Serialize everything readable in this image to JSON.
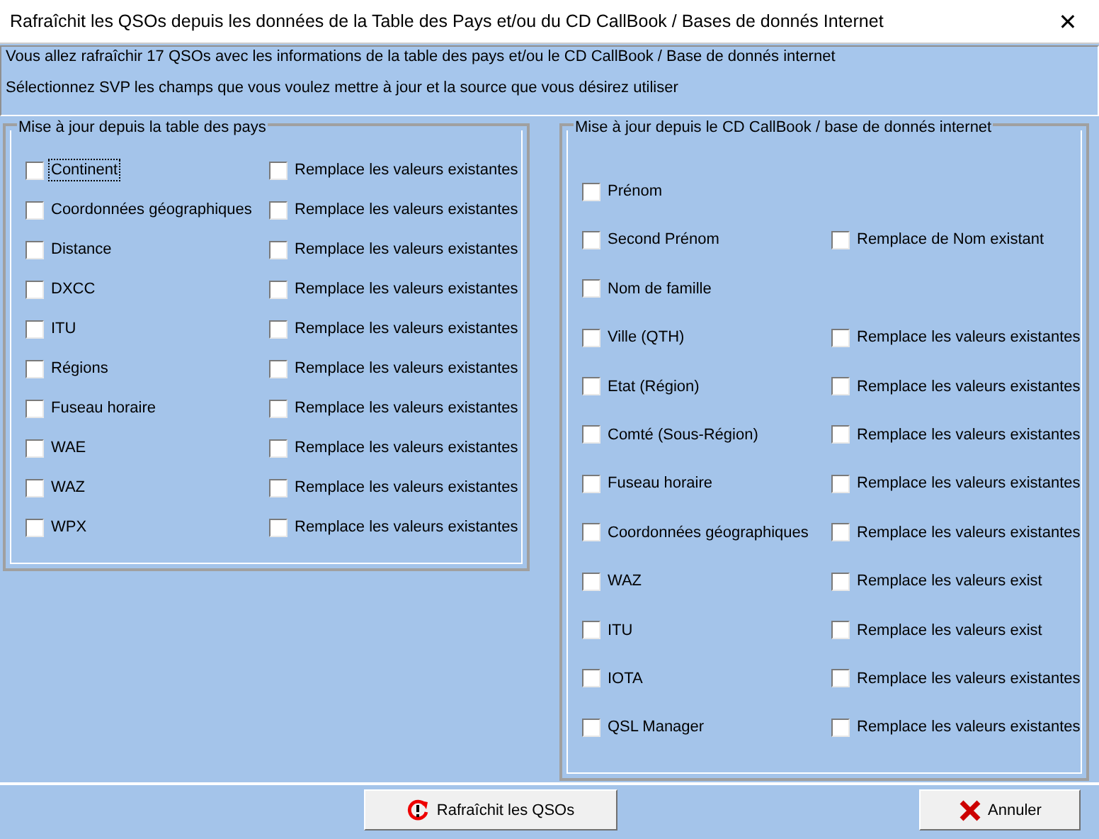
{
  "window": {
    "title": "Rafraîchit les QSOs depuis les données de la Table des Pays et/ou du CD CallBook / Bases de donnés Internet",
    "close": "✕"
  },
  "info": [
    "Vous allez rafraîchir 17 QSOs avec les informations de la table des pays et/ou le CD CallBook / Base de donnés internet",
    "Sélectionnez SVP les champs que vous voulez mettre à jour et la source que vous désirez utiliser"
  ],
  "groups": [
    {
      "title": "Mise à jour depuis la table des pays",
      "rows": [
        {
          "label": "Continent",
          "checked": false,
          "focused": true,
          "replace": {
            "label": "Remplace les valeurs existantes",
            "checked": false
          }
        },
        {
          "label": "Coordonnées géographiques",
          "checked": false,
          "focused": false,
          "replace": {
            "label": "Remplace les valeurs existantes",
            "checked": false
          }
        },
        {
          "label": "Distance",
          "checked": false,
          "focused": false,
          "replace": {
            "label": "Remplace les valeurs existantes",
            "checked": false
          }
        },
        {
          "label": "DXCC",
          "checked": false,
          "focused": false,
          "replace": {
            "label": "Remplace les valeurs existantes",
            "checked": false
          }
        },
        {
          "label": "ITU",
          "checked": false,
          "focused": false,
          "replace": {
            "label": "Remplace les valeurs existantes",
            "checked": false
          }
        },
        {
          "label": "Régions",
          "checked": false,
          "focused": false,
          "replace": {
            "label": "Remplace les valeurs existantes",
            "checked": false
          }
        },
        {
          "label": "Fuseau horaire",
          "checked": false,
          "focused": false,
          "replace": {
            "label": "Remplace les valeurs existantes",
            "checked": false
          }
        },
        {
          "label": "WAE",
          "checked": false,
          "focused": false,
          "replace": {
            "label": "Remplace les valeurs existantes",
            "checked": false
          }
        },
        {
          "label": "WAZ",
          "checked": false,
          "focused": false,
          "replace": {
            "label": "Remplace les valeurs existantes",
            "checked": false
          }
        },
        {
          "label": "WPX",
          "checked": false,
          "focused": false,
          "replace": {
            "label": "Remplace les valeurs existantes",
            "checked": false
          }
        }
      ]
    },
    {
      "title": "Mise à jour depuis le CD CallBook / base de donnés internet",
      "rows": [
        {
          "label": "Prénom",
          "checked": false,
          "focused": false
        },
        {
          "label": "Second Prénom",
          "checked": false,
          "focused": false,
          "replace": {
            "label": "Remplace de Nom existant",
            "checked": false
          }
        },
        {
          "label": "Nom de famille",
          "checked": false,
          "focused": false
        },
        {
          "label": "Ville (QTH)",
          "checked": false,
          "focused": false,
          "replace": {
            "label": "Remplace les valeurs existantes",
            "checked": false
          }
        },
        {
          "label": "Etat (Région)",
          "checked": false,
          "focused": false,
          "replace": {
            "label": "Remplace les valeurs existantes",
            "checked": false
          }
        },
        {
          "label": "Comté (Sous-Région)",
          "checked": false,
          "focused": false,
          "replace": {
            "label": "Remplace les valeurs existantes",
            "checked": false
          }
        },
        {
          "label": "Fuseau horaire",
          "checked": false,
          "focused": false,
          "replace": {
            "label": "Remplace les valeurs existantes",
            "checked": false
          }
        },
        {
          "label": "Coordonnées géographiques",
          "checked": false,
          "focused": false,
          "replace": {
            "label": "Remplace les valeurs existantes",
            "checked": false
          }
        },
        {
          "label": "WAZ",
          "checked": false,
          "focused": false,
          "replace": {
            "label": "Remplace les valeurs exist",
            "checked": false
          }
        },
        {
          "label": "ITU",
          "checked": false,
          "focused": false,
          "replace": {
            "label": "Remplace les valeurs exist",
            "checked": false
          }
        },
        {
          "label": "IOTA",
          "checked": false,
          "focused": false,
          "replace": {
            "label": "Remplace les valeurs existantes",
            "checked": false
          }
        },
        {
          "label": "QSL Manager",
          "checked": false,
          "focused": false,
          "replace": {
            "label": "Remplace les valeurs existantes",
            "checked": false
          }
        }
      ]
    }
  ],
  "buttons": [
    {
      "kind": "refresh",
      "label": "Rafraîchit les QSOs"
    },
    {
      "kind": "cancel",
      "label": "Annuler"
    }
  ]
}
